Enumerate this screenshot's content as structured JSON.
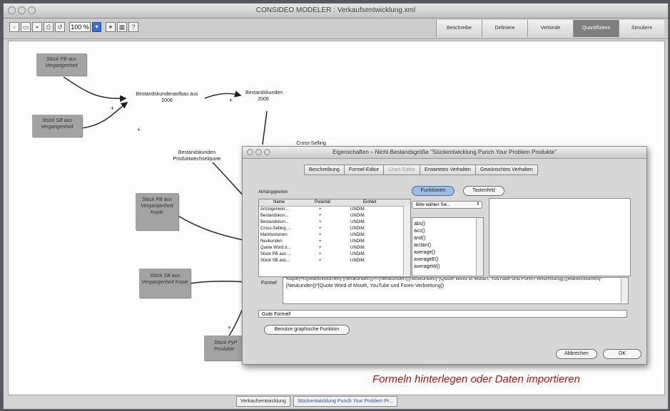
{
  "window": {
    "title": "CONSIDEO MODELER : Verkaufsentwicklung.xml"
  },
  "toolbar": {
    "zoom": "100 %"
  },
  "mode_tabs": [
    {
      "label": "Beschreibe",
      "active": false
    },
    {
      "label": "Definiere",
      "active": false
    },
    {
      "label": "Verbinde",
      "active": false
    },
    {
      "label": "Quantifiziere",
      "active": true
    },
    {
      "label": "Simuliere",
      "active": false
    }
  ],
  "canvas": {
    "nodes": {
      "pb_vergangenheit": "Stück PB aus Vergangenheit",
      "sb_vergangenheit": "Stück SB aus Vergangenheit",
      "bestandskundenaufbau": "Bestandskundenaufbau aus 2006",
      "bestandskunden_2006": "Bestandskunden 2006",
      "bestandskunden_quote": "Bestandskunden Produktwechselquote",
      "cross_selling": "Cross-Selling",
      "pb_kopie": "Stück PB aus Vergangenheit Kopie",
      "sb_kopie": "Stück SB aus Vergangenheit Kopie",
      "pyp_produkte": "Stück PyP Produkte"
    },
    "plus_sign": "+"
  },
  "dialog": {
    "title": "Eigenschaften – Nicht-Bestandsgröße \"Stückentwicklung Punch Your Problem Produkte\"",
    "tabs": [
      {
        "label": "Beschreibung",
        "disabled": false
      },
      {
        "label": "Formel-Editor",
        "disabled": false
      },
      {
        "label": "Chart-Editor",
        "disabled": true
      },
      {
        "label": "Erwartetes Verhalten",
        "disabled": false
      },
      {
        "label": "Gewünschtes Verhalten",
        "disabled": false
      }
    ],
    "dependencies_label": "Abhängigkeiten",
    "dep_headers": [
      "Name",
      "Polarität",
      "Einheit"
    ],
    "dependencies": [
      {
        "name": "Anzeigenwer...",
        "polarity": "+",
        "unit": "UNDIM."
      },
      {
        "name": "Bestandskun...",
        "polarity": "+",
        "unit": "UNDIM."
      },
      {
        "name": "Bestandskun...",
        "polarity": "+",
        "unit": "UNDIM."
      },
      {
        "name": "Cross-Selling ...",
        "polarity": "+",
        "unit": "UNDIM."
      },
      {
        "name": "Marktvolumen",
        "polarity": "+",
        "unit": "UNDIM."
      },
      {
        "name": "Neukunden",
        "polarity": "+",
        "unit": "UNDIM."
      },
      {
        "name": "Quote Word o...",
        "polarity": "+",
        "unit": "UNDIM."
      },
      {
        "name": "Stück PB aus ...",
        "polarity": "+",
        "unit": "UNDIM."
      },
      {
        "name": "Stück SB aus...",
        "polarity": "+",
        "unit": "UNDIM."
      }
    ],
    "functions_button": "Funktionen",
    "keypad_button": "Tastenfeld",
    "select_placeholder": "Bitte wählen Sie...",
    "functions": [
      "abs()",
      "acc()",
      "and()",
      "arctan()",
      "average()",
      "averageE()",
      "averageW()"
    ],
    "formel_label": "Formel",
    "formula": "Kopie]+if([Marktvolumen]-[Neukunden])>=[Neukunden],[Neukunden]*[Quote Word of Mouth, YouTube und Foren-Verbreitung],([Marktvolumen]-[Neukunden])*[Quote Word of Mouth, YouTube und Foren-Verbreitung])",
    "status": "Gute Formel!",
    "graphic_button": "Benutze graphische Funktion",
    "cancel_button": "Abbrechen",
    "ok_button": "OK"
  },
  "caption": "Formeln hinterlegen oder Daten importieren",
  "bottom_tabs": [
    "Verkaufsentwicklung",
    "Stückentwicklung Punch Your Problem Pr..."
  ]
}
